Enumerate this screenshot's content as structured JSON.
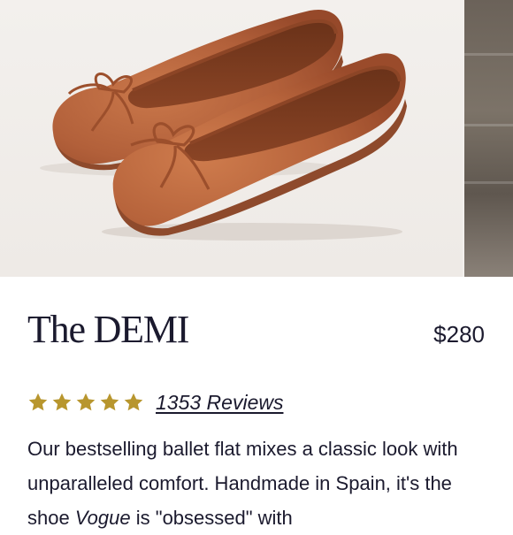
{
  "product": {
    "title": "The DEMI",
    "price": "$280",
    "image_alt": "Cognac leather ballet flats with bow",
    "color_name": "cognac",
    "colors": {
      "leather": "#b5633a",
      "lining": "#7a3c20",
      "background": "#f2efec",
      "star": "#b8962e",
      "text": "#1b1a2e"
    }
  },
  "rating": {
    "stars": 5,
    "star_icon": "star-icon",
    "reviews_label": "1353 Reviews"
  },
  "description": {
    "line_1": "Our bestselling ballet flat mixes a classic look with",
    "line_2": "unparalleled comfort. Handmade in Spain, it's the",
    "line_3_pre": "shoe ",
    "line_3_em": "Vogue",
    "line_3_post": " is \"obsessed\" with"
  }
}
